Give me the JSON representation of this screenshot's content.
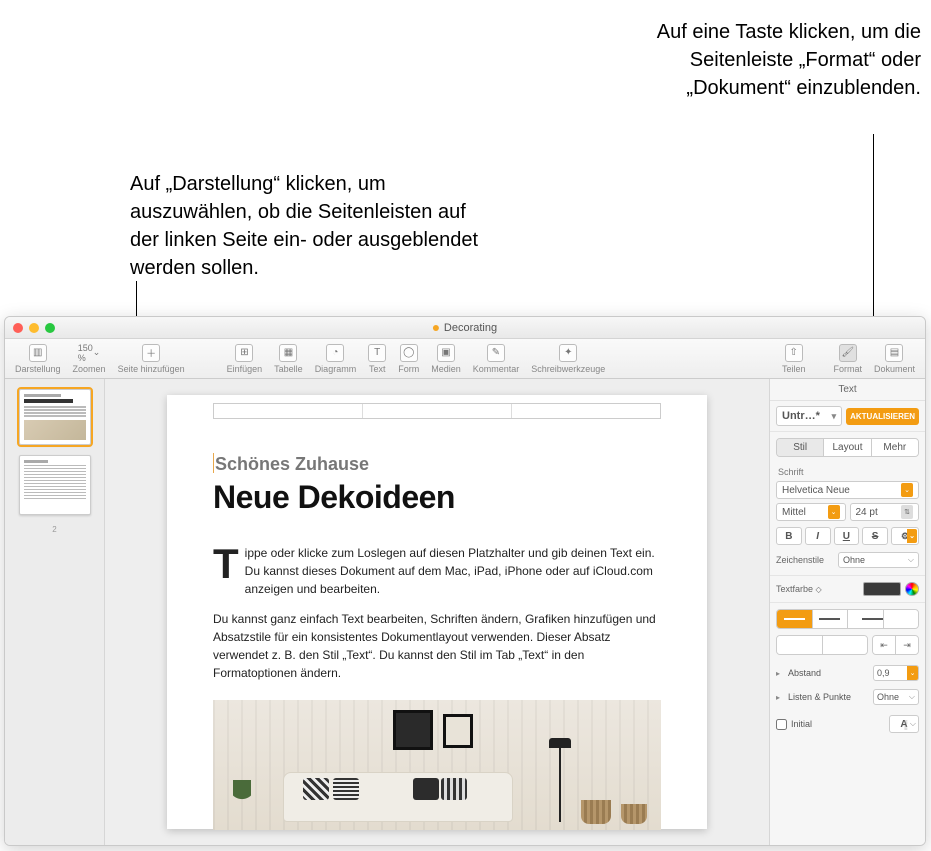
{
  "callouts": {
    "right": "Auf eine Taste klicken, um die Seitenleiste „Format“ oder „Dokument“ einzublenden.",
    "left": "Auf „Darstellung“ klicken, um auszuwählen, ob die Seitenleisten auf der linken Seite ein- oder ausgeblendet werden sollen."
  },
  "window_title": "Decorating",
  "toolbar": {
    "view": "Darstellung",
    "zoom": "Zoomen",
    "zoom_value": "150 %",
    "add_page": "Seite hinzufügen",
    "insert": "Einfügen",
    "table": "Tabelle",
    "chart": "Diagramm",
    "text": "Text",
    "shape": "Form",
    "media": "Medien",
    "comment": "Kommentar",
    "writing_tools": "Schreibwerkzeuge",
    "share": "Teilen",
    "format": "Format",
    "document": "Dokument"
  },
  "page": {
    "kicker": "Schönes Zuhause",
    "headline": "Neue Dekoideen",
    "dropcap": "T",
    "body1": "ippe oder klicke zum Loslegen auf diesen Platzhalter und gib deinen Text ein. Du kannst dieses Dokument auf dem Mac, iPad, iPhone oder auf iCloud.com anzeigen und bearbeiten.",
    "body2": "Du kannst ganz einfach Text bearbeiten, Schriften ändern, Grafiken hinzufügen und Absatzstile für ein konsistentes Dokumentlayout verwenden. Dieser Absatz verwendet z. B. den Stil „Text“. Du kannst den Stil im Tab „Text“ in den Formatoptionen ändern."
  },
  "thumbnails": {
    "page_count_indicator": "2",
    "thumb1_title": "Neue Dekoideen"
  },
  "inspector": {
    "panel_title": "Text",
    "style_name": "Untr…*",
    "update": "AKTUALISIEREN",
    "tabs": {
      "style": "Stil",
      "layout": "Layout",
      "more": "Mehr"
    },
    "font_label": "Schrift",
    "font_family": "Helvetica Neue",
    "font_weight": "Mittel",
    "font_size": "24 pt",
    "bold": "B",
    "italic": "I",
    "underline": "U",
    "strike": "S",
    "char_styles": "Zeichenstile",
    "char_styles_val": "Ohne",
    "text_color": "Textfarbe",
    "spacing": "Abstand",
    "spacing_val": "0,9",
    "bullets": "Listen & Punkte",
    "bullets_val": "Ohne",
    "initial": "Initial",
    "initial_glyph": "A"
  }
}
